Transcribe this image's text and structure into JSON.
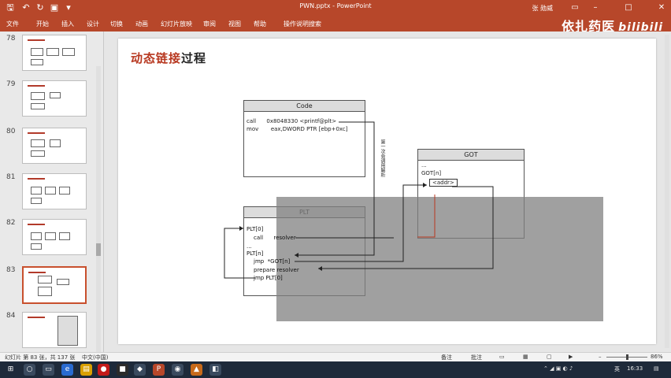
{
  "window": {
    "title": "PWN.pptx  -  PowerPoint",
    "user": "张 勋威",
    "brand_text": "依扎药医",
    "brand_logo": "bilibili"
  },
  "menu": {
    "tabs": [
      "文件",
      "开始",
      "插入",
      "设计",
      "切换",
      "动画",
      "幻灯片放映",
      "审阅",
      "视图",
      "帮助",
      "操作说明搜索"
    ]
  },
  "thumbnails": {
    "numbers": [
      "78",
      "79",
      "80",
      "81",
      "82",
      "83",
      "84"
    ]
  },
  "slide": {
    "title_red": "动态链接",
    "title_dark": "过程",
    "code_box": {
      "header": "Code",
      "line1": "call      0x8048330 <printf@plt>",
      "line2": "mov       eax,DWORD PTR [ebp+0xc]"
    },
    "got_box": {
      "header": "GOT",
      "line1": "...",
      "line2": "GOT[n]",
      "line3": "<addr>"
    },
    "plt_box": {
      "header": "PLT",
      "line1": "PLT[0]",
      "line2": "call      resolver",
      "line3": "...",
      "line4": "PLT[n]",
      "line5": "jmp  *GOT[n]",
      "line6": "prepare resolver",
      "line7": "jmp PLT[0]"
    },
    "side_note": "第一次会调用解析"
  },
  "status": {
    "slide_info": "幻灯片 第 83 张，共 137 张",
    "lang": "中文(中国)",
    "notes": "备注",
    "comments": "批注",
    "zoom": "86%"
  },
  "taskbar": {
    "lang": "英",
    "time": "16:33"
  }
}
